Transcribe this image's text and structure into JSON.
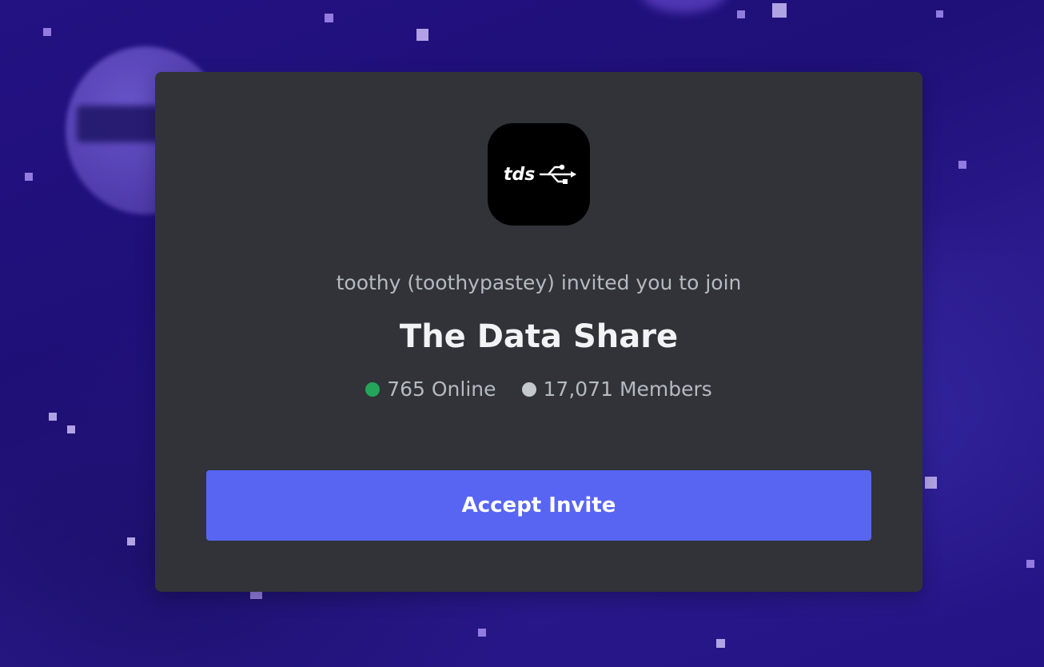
{
  "invite": {
    "server_icon": {
      "logo_text": "tds",
      "icon_name": "usb-icon",
      "background_color": "#000000"
    },
    "inviter_text": "toothy (toothypastey) invited you to join",
    "server_name": "The Data Share",
    "online": {
      "label": "765 Online",
      "dot_color": "#23a55a"
    },
    "members": {
      "label": "17,071 Members",
      "dot_color": "#c4c9ce"
    },
    "accept_button_label": "Accept Invite"
  },
  "colors": {
    "card_background": "#313338",
    "accent": "#5865f2"
  }
}
